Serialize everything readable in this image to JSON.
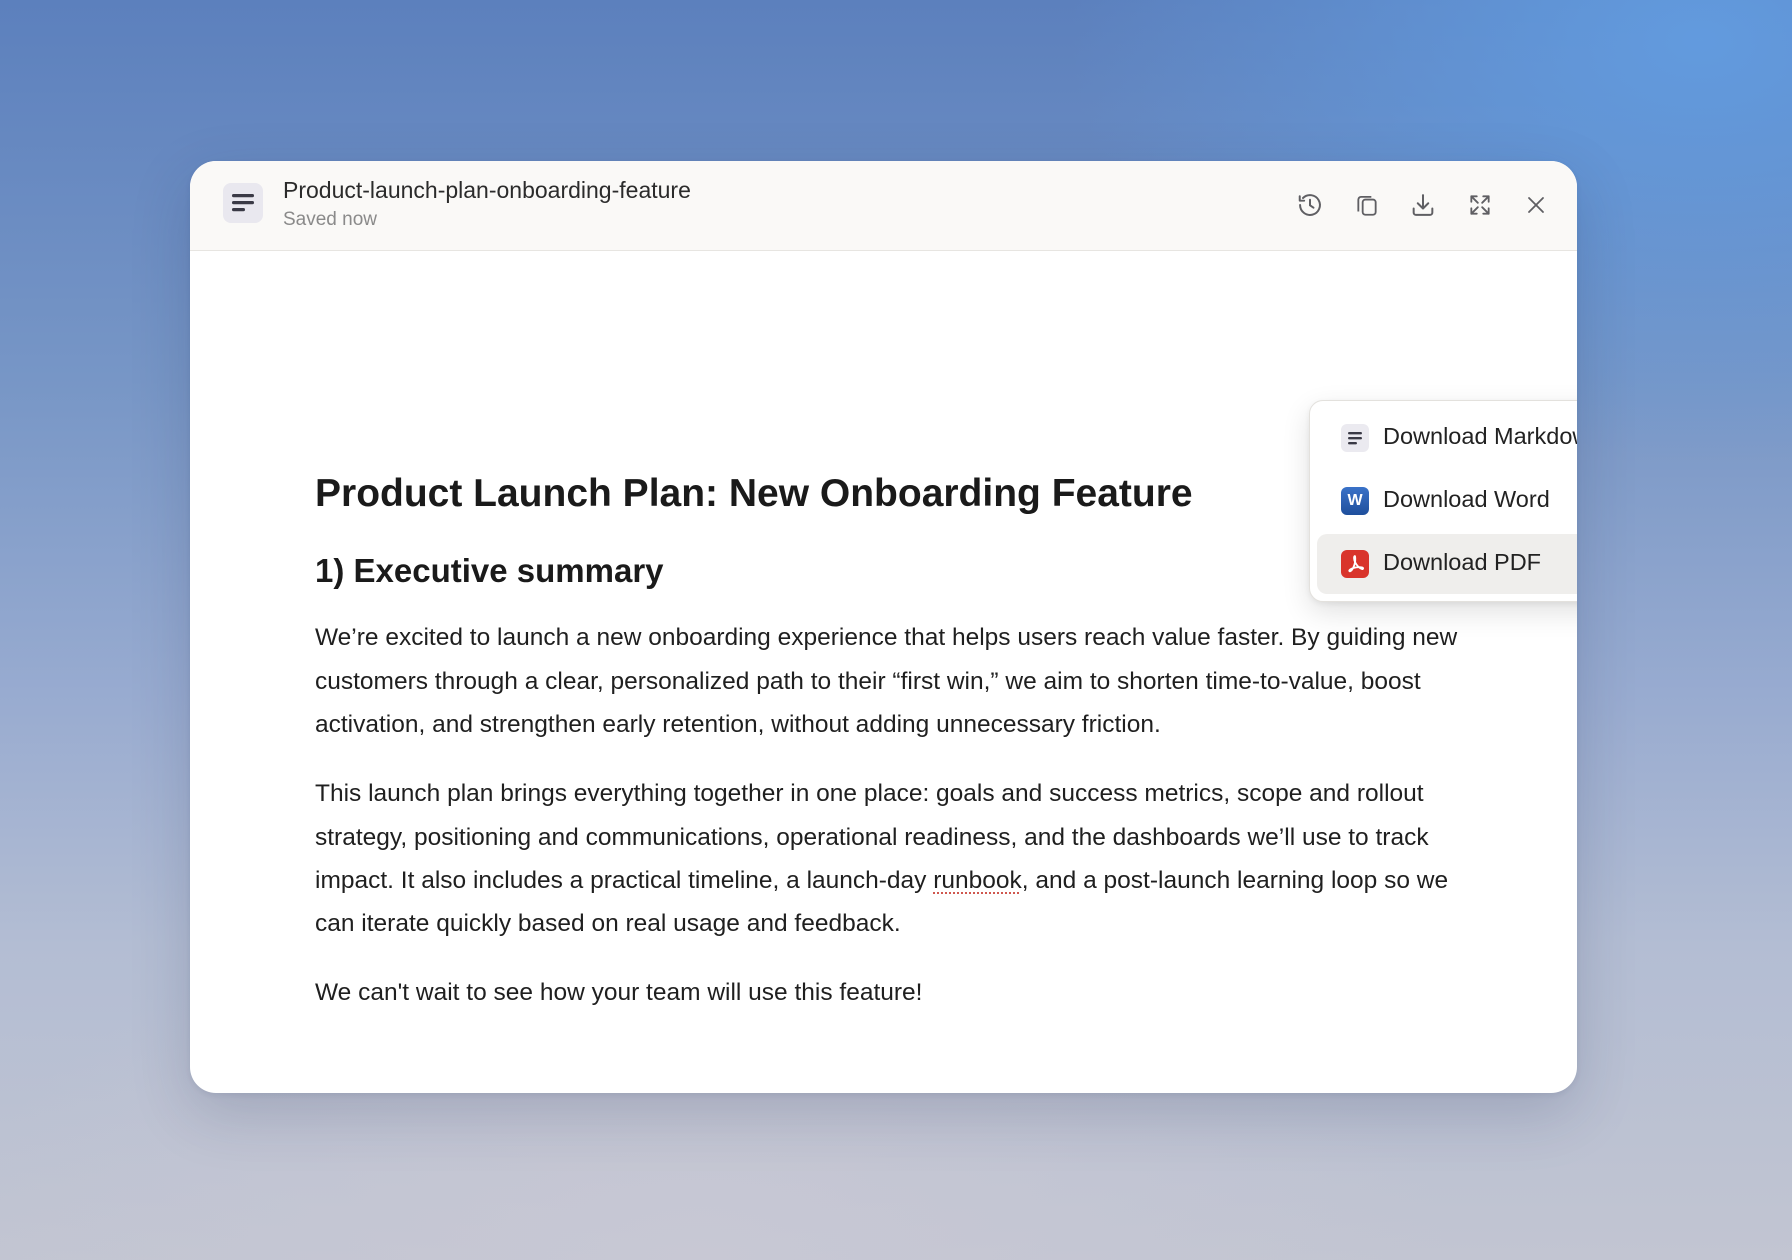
{
  "window": {
    "title": "Product-launch-plan-onboarding-feature",
    "status": "Saved now",
    "doc_icon": "document-lines-icon"
  },
  "toolbar": {
    "buttons": [
      {
        "name": "history-icon"
      },
      {
        "name": "copy-icon"
      },
      {
        "name": "download-icon"
      },
      {
        "name": "expand-icon"
      },
      {
        "name": "close-icon"
      }
    ]
  },
  "download_menu": {
    "items": [
      {
        "label": "Download Markdown",
        "icon": "markdown-file-icon"
      },
      {
        "label": "Download Word",
        "icon": "word-file-icon",
        "icon_letter": "W",
        "icon_color": "#2b579a"
      },
      {
        "label": "Download PDF",
        "icon": "pdf-file-icon",
        "icon_color": "#d9342b",
        "highlighted": true
      }
    ]
  },
  "document": {
    "heading": "Product Launch Plan: New Onboarding Feature",
    "section_heading": "1) Executive summary",
    "paragraph_1": "We’re excited to launch a new onboarding experience that helps users reach value faster. By guiding new customers through a clear, personalized path to their “first win,” we aim to shorten time-to-value, boost activation, and strengthen early retention, without adding unnecessary friction.",
    "paragraph_2_before": "This launch plan brings everything together in one place: goals and success metrics, scope and rollout strategy, positioning and communications, operational readiness, and the dashboards we’ll use to track impact. It also includes a practical timeline, a launch-day ",
    "paragraph_2_flagged_word": "runbook",
    "paragraph_2_after": ", and a post-launch learning loop so we can iterate quickly based on real usage and feedback.",
    "paragraph_3": "We can't wait to see how your team will use this feature!"
  },
  "colors": {
    "accent_word": "#2b579a",
    "accent_pdf": "#d9342b",
    "menu_highlight": "#efeeec"
  }
}
